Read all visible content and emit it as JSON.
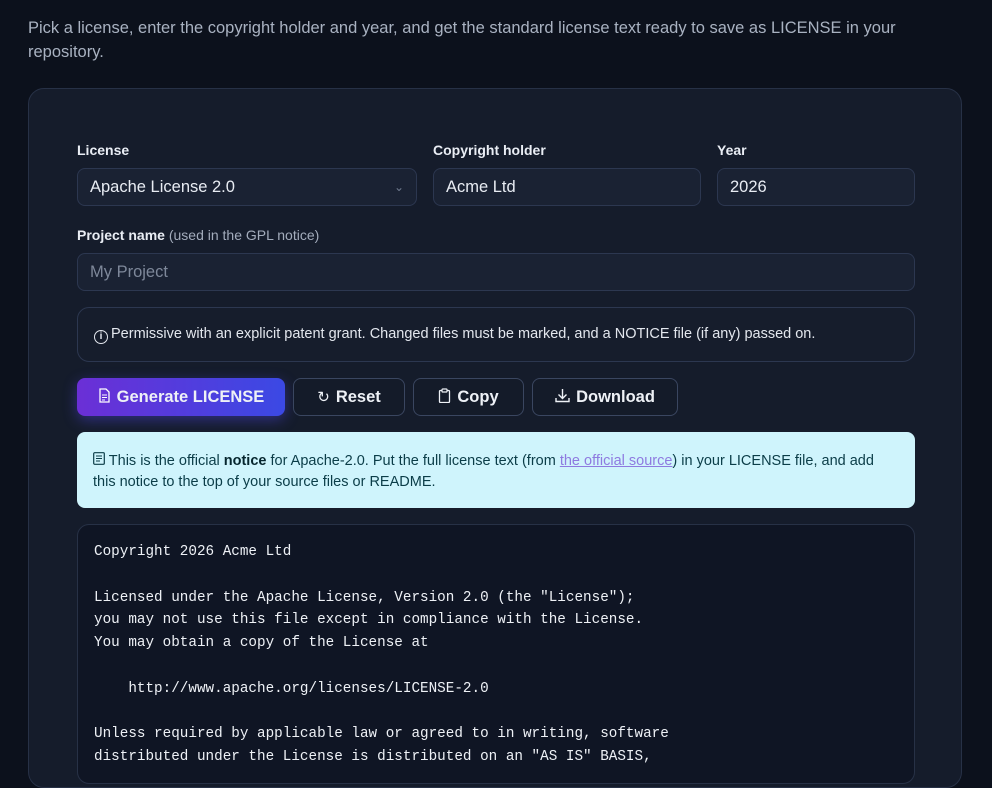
{
  "intro": "Pick a license, enter the copyright holder and year, and get the standard license text ready to save as LICENSE in your repository.",
  "form": {
    "license_label": "License",
    "license_value": "Apache License 2.0",
    "holder_label": "Copyright holder",
    "holder_value": "Acme Ltd",
    "year_label": "Year",
    "year_value": "2026",
    "project_label": "Project name",
    "project_hint": "(used in the GPL notice)",
    "project_placeholder": "My Project"
  },
  "info": {
    "icon": "info-circle-icon",
    "text": "Permissive with an explicit patent grant. Changed files must be marked, and a NOTICE file (if any) passed on."
  },
  "buttons": {
    "generate": "Generate LICENSE",
    "reset": "Reset",
    "copy": "Copy",
    "download": "Download"
  },
  "notice": {
    "icon": "document-icon",
    "pre": "This is the official ",
    "bold": "notice",
    "mid": " for Apache-2.0. Put the full license text (from ",
    "link": "the official source",
    "post": ") in your LICENSE file, and add this notice to the top of your source files or README."
  },
  "output": "Copyright 2026 Acme Ltd\n\nLicensed under the Apache License, Version 2.0 (the \"License\");\nyou may not use this file except in compliance with the License.\nYou may obtain a copy of the License at\n\n    http://www.apache.org/licenses/LICENSE-2.0\n\nUnless required by applicable law or agreed to in writing, software\ndistributed under the License is distributed on an \"AS IS\" BASIS,",
  "colors": {
    "primary_gradient_start": "#6b2fd6",
    "primary_gradient_end": "#3b49e4",
    "notice_bg": "#cff4fc",
    "link": "#8e7ae0"
  }
}
